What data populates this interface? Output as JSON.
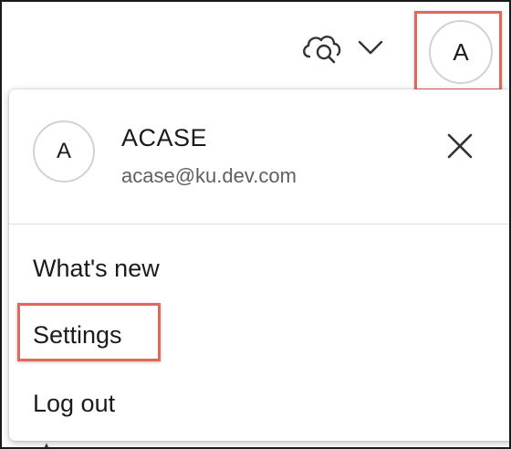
{
  "topbar": {
    "search_cloud_icon": "cloud-search-icon",
    "chevron_icon": "chevron-down-icon",
    "avatar_initial": "A"
  },
  "menu": {
    "avatar_initial": "A",
    "user_name": "ACASE",
    "user_email": "acase@ku.dev.com",
    "close_icon": "close-icon",
    "items": [
      {
        "label": "What's new"
      },
      {
        "label": "Settings"
      },
      {
        "label": "Log out"
      }
    ]
  },
  "colors": {
    "highlight": "#e0695c",
    "text": "#1b1b1b",
    "secondary_text": "#5f5f5f",
    "avatar_border": "#d2d2d2"
  }
}
